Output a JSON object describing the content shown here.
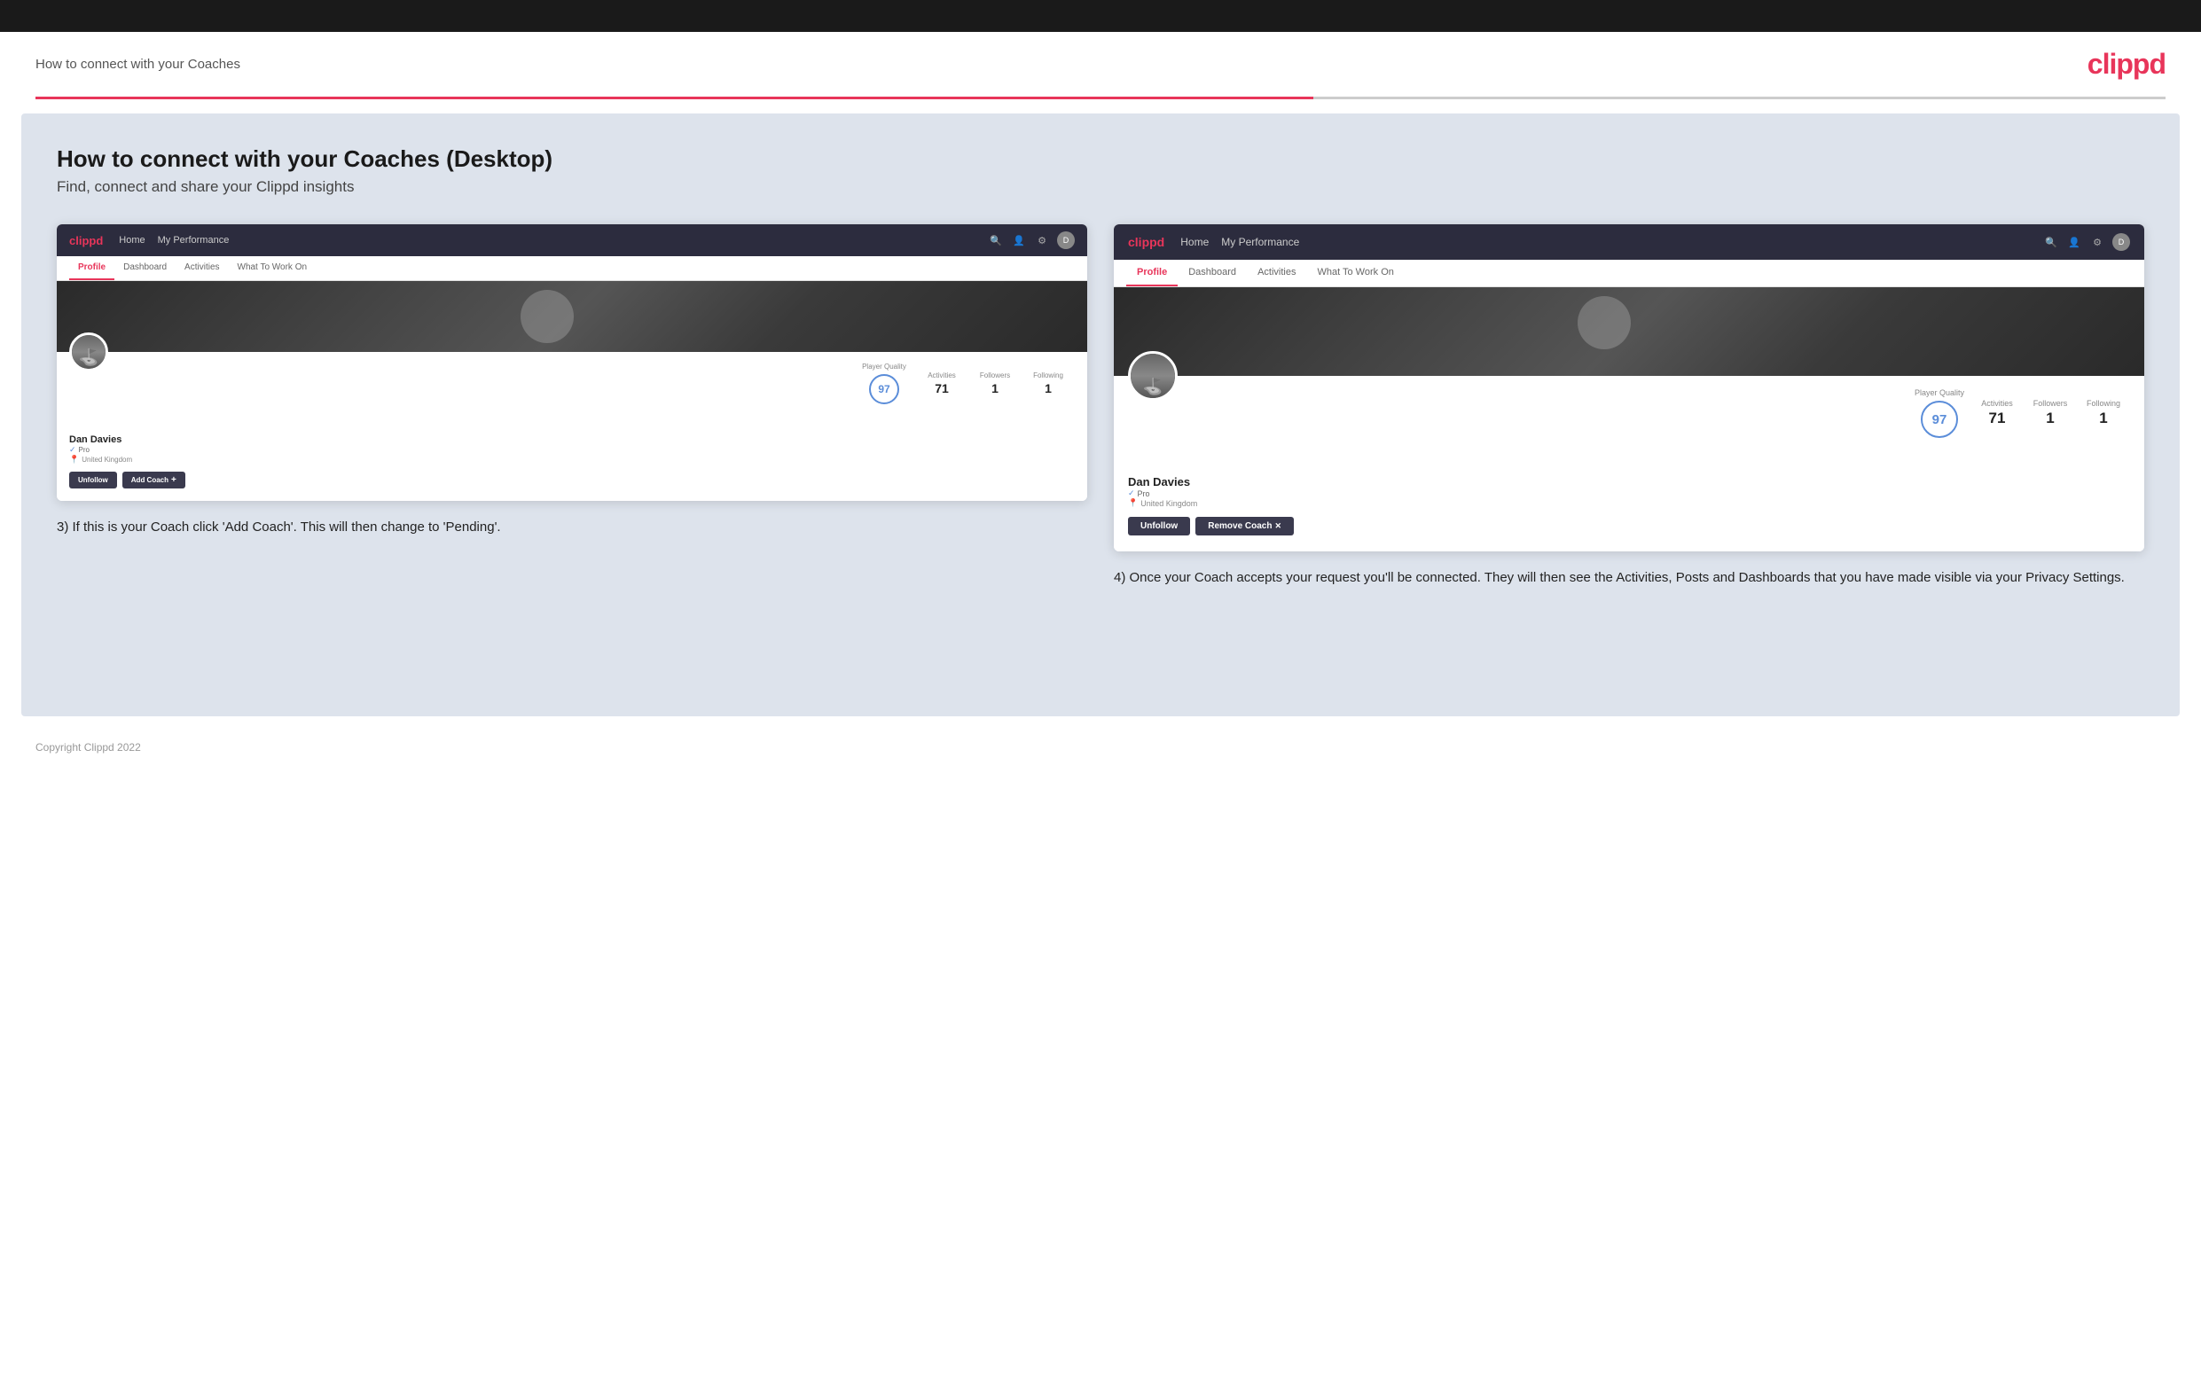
{
  "topbar": {},
  "header": {
    "title": "How to connect with your Coaches",
    "logo": "clippd"
  },
  "main": {
    "heading": "How to connect with your Coaches (Desktop)",
    "subheading": "Find, connect and share your Clippd insights",
    "left_screenshot": {
      "nav": {
        "logo": "clippd",
        "links": [
          "Home",
          "My Performance"
        ]
      },
      "tabs": [
        "Profile",
        "Dashboard",
        "Activities",
        "What To Work On"
      ],
      "active_tab": "Profile",
      "player": {
        "name": "Dan Davies",
        "badge": "Pro",
        "location": "United Kingdom",
        "player_quality": "97",
        "activities": "71",
        "followers": "1",
        "following": "1"
      },
      "buttons": [
        "Unfollow",
        "Add Coach"
      ]
    },
    "right_screenshot": {
      "nav": {
        "logo": "clippd",
        "links": [
          "Home",
          "My Performance"
        ]
      },
      "tabs": [
        "Profile",
        "Dashboard",
        "Activities",
        "What To Work On"
      ],
      "active_tab": "Profile",
      "player": {
        "name": "Dan Davies",
        "badge": "Pro",
        "location": "United Kingdom",
        "player_quality": "97",
        "activities": "71",
        "followers": "1",
        "following": "1"
      },
      "buttons": [
        "Unfollow",
        "Remove Coach"
      ]
    },
    "left_caption": "3) If this is your Coach click 'Add Coach'. This will then change to 'Pending'.",
    "right_caption": "4) Once your Coach accepts your request you'll be connected. They will then see the Activities, Posts and Dashboards that you have made visible via your Privacy Settings.",
    "stat_labels": {
      "player_quality": "Player Quality",
      "activities": "Activities",
      "followers": "Followers",
      "following": "Following"
    }
  },
  "footer": {
    "copyright": "Copyright Clippd 2022"
  }
}
